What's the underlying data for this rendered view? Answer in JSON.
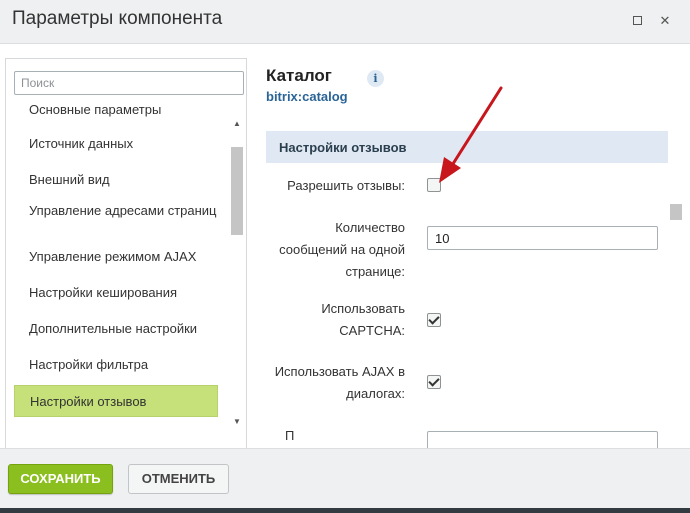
{
  "dialog": {
    "title": "Параметры компонента"
  },
  "sidebar": {
    "search_placeholder": "Поиск",
    "items": [
      {
        "label": "Основные параметры"
      },
      {
        "label": "Источник данных"
      },
      {
        "label": "Внешний вид"
      },
      {
        "label": "Управление адресами страниц"
      },
      {
        "label": "Управление режимом AJAX"
      },
      {
        "label": "Настройки кеширования"
      },
      {
        "label": "Дополнительные настройки"
      },
      {
        "label": "Настройки фильтра"
      },
      {
        "label": "Настройки отзывов",
        "active": true
      }
    ]
  },
  "component": {
    "name": "Каталог",
    "code": "bitrix:catalog",
    "info_icon": "info-icon"
  },
  "section": {
    "title": "Настройки отзывов",
    "fields": [
      {
        "label": "Разрешить отзывы:",
        "type": "checkbox",
        "checked": false
      },
      {
        "label": "Количество сообщений на одной странице:",
        "type": "text",
        "value": "10"
      },
      {
        "label": "Использовать CAPTCHA:",
        "type": "checkbox",
        "checked": true
      },
      {
        "label": "Использовать AJAX в диалогах:",
        "type": "checkbox",
        "checked": true
      }
    ]
  },
  "footer": {
    "save_label": "СОХРАНИТЬ",
    "cancel_label": "ОТМЕНИТЬ"
  },
  "colors": {
    "accent_green": "#8bbf1f",
    "active_item": "#c6e17a",
    "section_head": "#e0e9f3",
    "arrow_red": "#c8161d",
    "link_blue": "#2a6496"
  }
}
